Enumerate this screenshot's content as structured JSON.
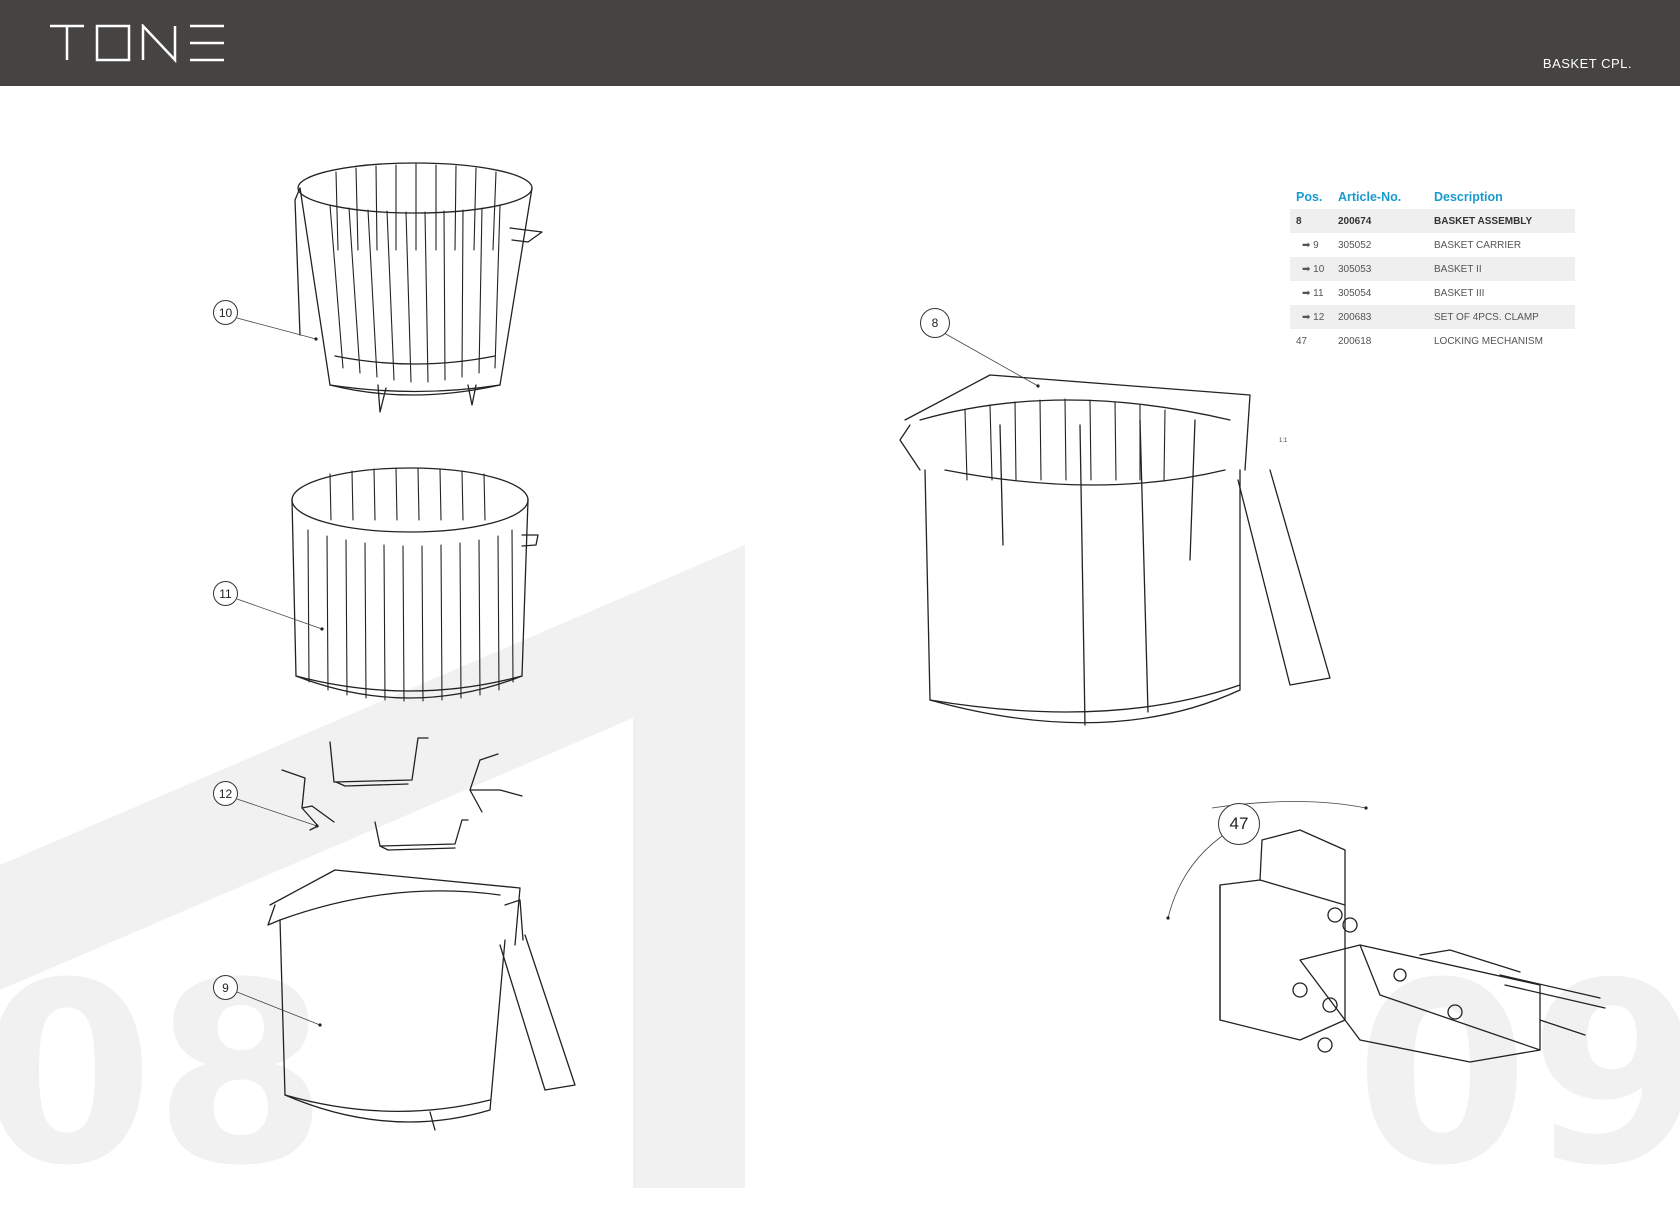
{
  "header": {
    "brand": "TONE",
    "section_title": "BASKET CPL."
  },
  "page_numbers": {
    "left": "08",
    "right": "09"
  },
  "parts_table": {
    "headers": {
      "pos": "Pos.",
      "article": "Article-No.",
      "description": "Description"
    },
    "rows": [
      {
        "pos": "8",
        "article": "200674",
        "description": "BASKET ASSEMBLY"
      },
      {
        "pos": "➡ 9",
        "article": "305052",
        "description": "BASKET CARRIER"
      },
      {
        "pos": "➡ 10",
        "article": "305053",
        "description": "BASKET II"
      },
      {
        "pos": "➡ 11",
        "article": "305054",
        "description": "BASKET III"
      },
      {
        "pos": "➡ 12",
        "article": "200683",
        "description": "SET OF 4PCS. CLAMP"
      },
      {
        "pos": "47",
        "article": "200618",
        "description": "LOCKING MECHANISM"
      }
    ]
  },
  "callouts": {
    "c10": "10",
    "c11": "11",
    "c12": "12",
    "c9": "9",
    "c8": "8",
    "c47": "47"
  },
  "scale_label": "1:1"
}
